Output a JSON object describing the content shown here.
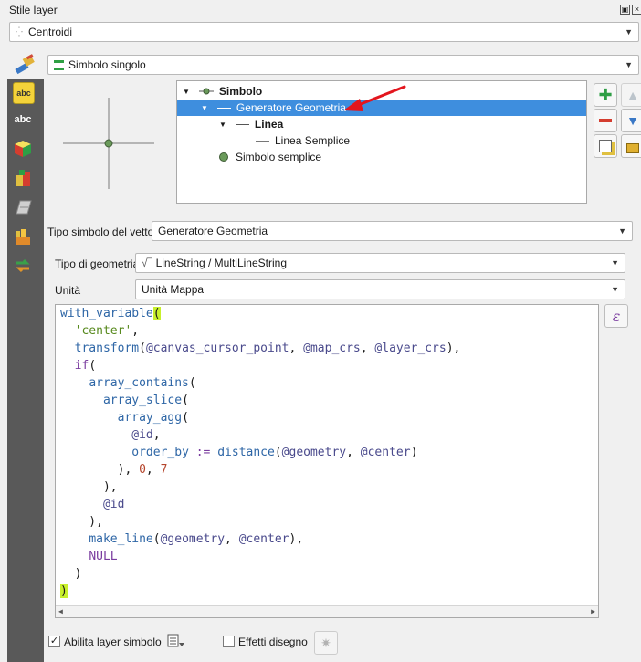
{
  "panel": {
    "title": "Stile layer"
  },
  "layer": {
    "name": "Centroidi"
  },
  "renderer": {
    "value": "Simbolo singolo"
  },
  "tree": {
    "items": [
      {
        "label": "Simbolo"
      },
      {
        "label": "Generatore Geometria"
      },
      {
        "label": "Linea"
      },
      {
        "label": "Linea Semplice"
      },
      {
        "label": "Simbolo semplice"
      }
    ]
  },
  "symbol_type": {
    "label": "Tipo simbolo del vettore",
    "value": "Generatore Geometria"
  },
  "geometry_type": {
    "label": "Tipo di geometria",
    "value": "LineString / MultiLineString"
  },
  "unit": {
    "label": "Unità",
    "value": "Unità Mappa"
  },
  "expression": {
    "lines": [
      "with_variable(",
      "  'center',",
      "  transform(@canvas_cursor_point, @map_crs, @layer_crs),",
      "  if(",
      "    array_contains(",
      "      array_slice(",
      "        array_agg(",
      "          @id,",
      "          order_by := distance(@geometry, @center)",
      "        ), 0, 7",
      "      ),",
      "      @id",
      "    ),",
      "    make_line(@geometry, @center),",
      "    NULL",
      "  )",
      ")"
    ]
  },
  "footer": {
    "enable_symbol_layer": "Abilita layer simbolo",
    "draw_effects": "Effetti disegno",
    "enable_checked": true,
    "effects_checked": false
  },
  "colors": {
    "selection": "#3e8ede",
    "annotation_arrow": "#e3161e",
    "highlight": "#c8f02c"
  }
}
